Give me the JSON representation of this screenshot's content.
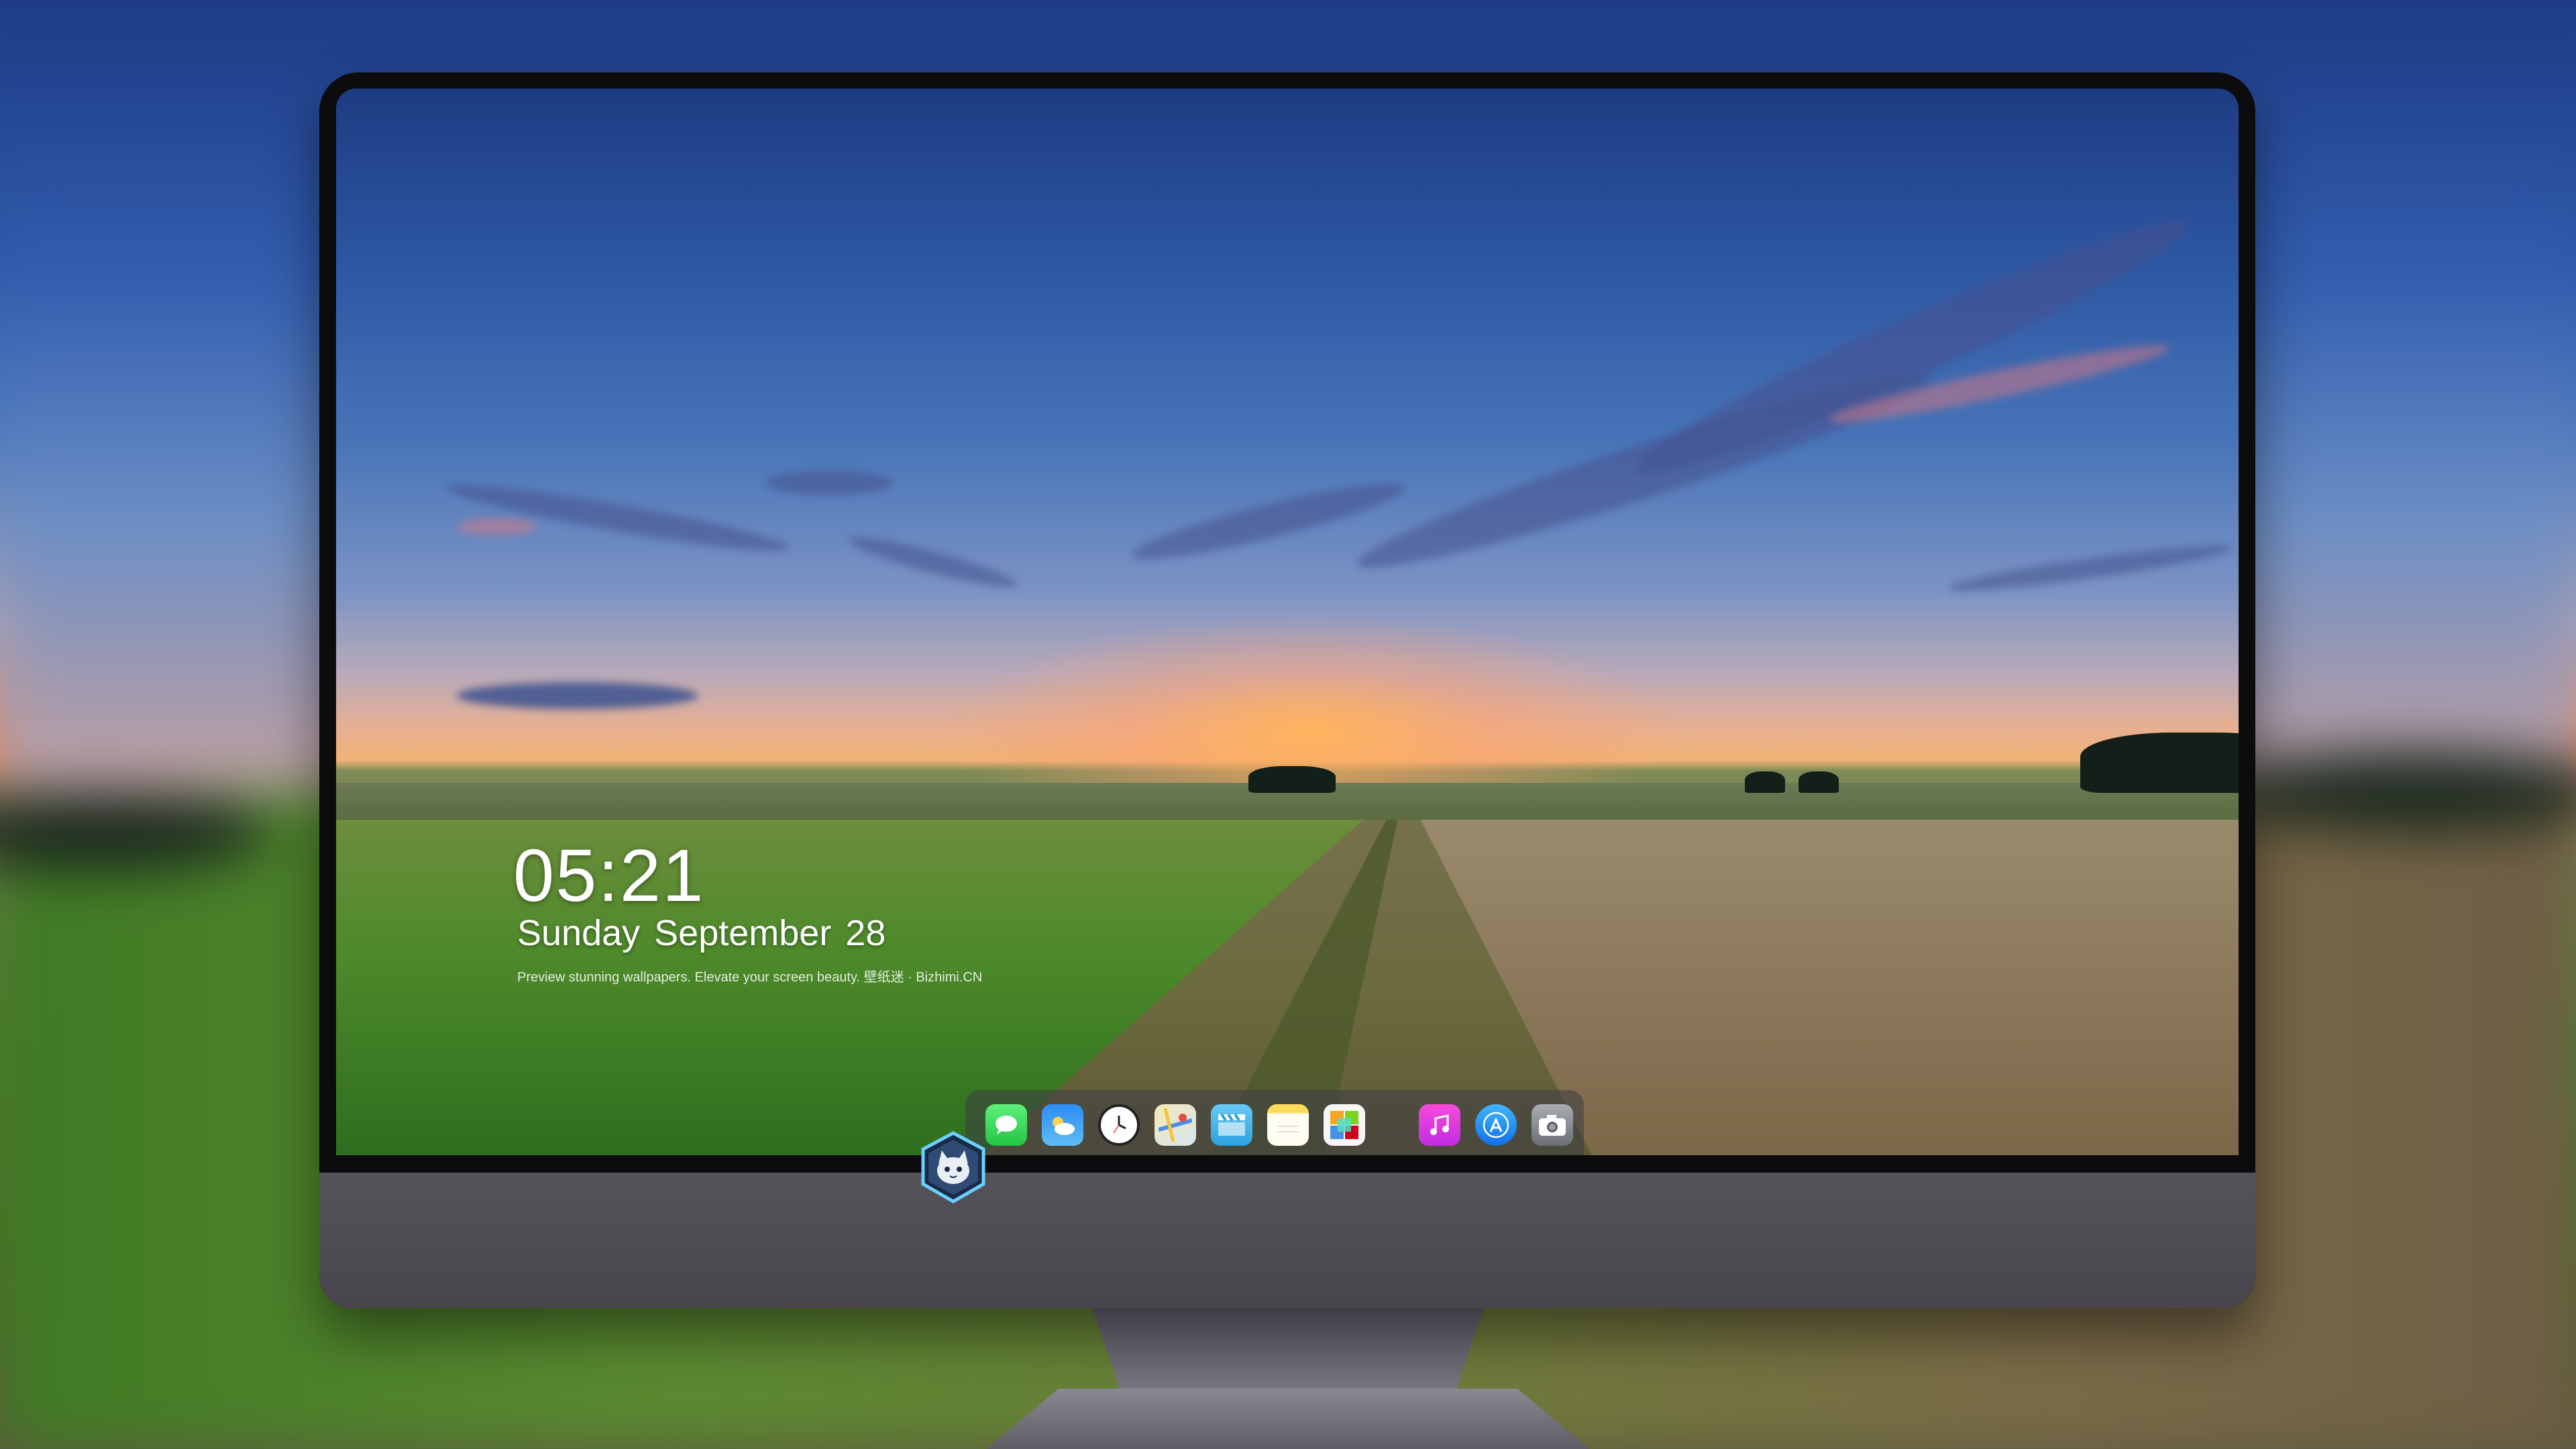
{
  "lockscreen": {
    "time": "05:21",
    "date": "Sunday September  28",
    "tagline": "Preview stunning wallpapers. Elevate your screen beauty. 壁纸迷 · Bizhimi.CN"
  },
  "dock": {
    "apps": [
      {
        "name": "messages-icon"
      },
      {
        "name": "weather-icon"
      },
      {
        "name": "clock-icon"
      },
      {
        "name": "maps-icon"
      },
      {
        "name": "clips-icon"
      },
      {
        "name": "notes-icon"
      },
      {
        "name": "photos-icon"
      },
      {
        "name": "music-icon"
      },
      {
        "name": "app-store-icon"
      },
      {
        "name": "camera-icon"
      }
    ]
  },
  "brand": {
    "logo": "cat-mascot-logo"
  },
  "colors": {
    "bezel": "#0c0c0e",
    "chin": "#4f4c54",
    "clock_text": "#ffffff"
  }
}
